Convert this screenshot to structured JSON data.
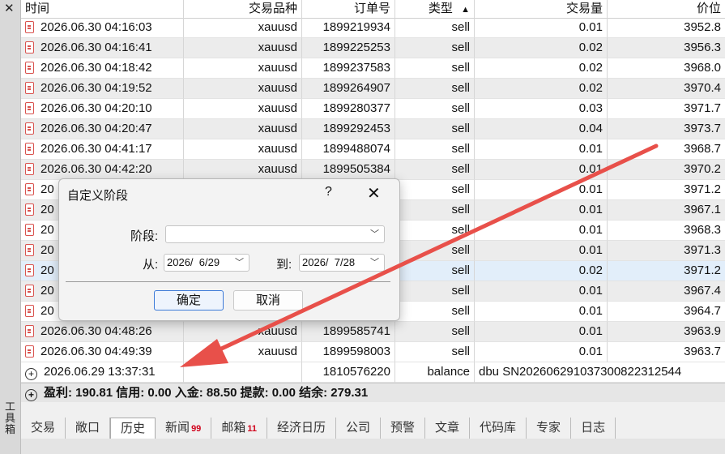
{
  "sidebar": {
    "close_glyph": "✕",
    "label": "工具箱"
  },
  "table": {
    "headers": [
      "时间",
      "交易品种",
      "订单号",
      "类型",
      "交易量",
      "价位"
    ],
    "sort_indicator": "▲",
    "rows": [
      [
        "2026.06.30 04:16:03",
        "xauusd",
        "1899219934",
        "sell",
        "0.01",
        "3952.8"
      ],
      [
        "2026.06.30 04:16:41",
        "xauusd",
        "1899225253",
        "sell",
        "0.02",
        "3956.3"
      ],
      [
        "2026.06.30 04:18:42",
        "xauusd",
        "1899237583",
        "sell",
        "0.02",
        "3968.0"
      ],
      [
        "2026.06.30 04:19:52",
        "xauusd",
        "1899264907",
        "sell",
        "0.02",
        "3970.4"
      ],
      [
        "2026.06.30 04:20:10",
        "xauusd",
        "1899280377",
        "sell",
        "0.03",
        "3971.7"
      ],
      [
        "2026.06.30 04:20:47",
        "xauusd",
        "1899292453",
        "sell",
        "0.04",
        "3973.7"
      ],
      [
        "2026.06.30 04:41:17",
        "xauusd",
        "1899488074",
        "sell",
        "0.01",
        "3968.7"
      ],
      [
        "2026.06.30 04:42:20",
        "xauusd",
        "1899505384",
        "sell",
        "0.01",
        "3970.2"
      ],
      [
        "20",
        "",
        "",
        "sell",
        "0.01",
        "3971.2"
      ],
      [
        "20",
        "",
        "",
        "sell",
        "0.01",
        "3967.1"
      ],
      [
        "20",
        "",
        "",
        "sell",
        "0.01",
        "3968.3"
      ],
      [
        "20",
        "",
        "",
        "sell",
        "0.01",
        "3971.3"
      ],
      [
        "20",
        "",
        "",
        "sell",
        "0.02",
        "3971.2"
      ],
      [
        "20",
        "",
        "",
        "sell",
        "0.01",
        "3967.4"
      ],
      [
        "20",
        "",
        "",
        "sell",
        "0.01",
        "3964.7"
      ],
      [
        "2026.06.30 04:48:26",
        "xauusd",
        "1899585741",
        "sell",
        "0.01",
        "3963.9"
      ],
      [
        "2026.06.30 04:49:39",
        "xauusd",
        "1899598003",
        "sell",
        "0.01",
        "3963.7"
      ]
    ],
    "balance_row": {
      "time": "2026.06.29 13:37:31",
      "order": "1810576220",
      "type": "balance",
      "comment": "dbu SN202606291037300822312544"
    },
    "summary": "盈利: 190.81  信用: 0.00  入金: 88.50  提款: 0.00  结余: 279.31"
  },
  "tabs": [
    {
      "label": "交易"
    },
    {
      "label": "敞口"
    },
    {
      "label": "历史",
      "active": true
    },
    {
      "label": "新闻",
      "badge": "99"
    },
    {
      "label": "邮箱",
      "badge": "11"
    },
    {
      "label": "经济日历"
    },
    {
      "label": "公司"
    },
    {
      "label": "预警"
    },
    {
      "label": "文章"
    },
    {
      "label": "代码库"
    },
    {
      "label": "专家"
    },
    {
      "label": "日志"
    }
  ],
  "dialog": {
    "title": "自定义阶段",
    "help": "?",
    "close": "✕",
    "period_label": "阶段:",
    "period_value": "",
    "from_label": "从:",
    "from_value": "2026/  6/29",
    "to_label": "到:",
    "to_value": "2026/  7/28",
    "ok_label": "确定",
    "cancel_label": "取消"
  },
  "colors": {
    "arrow": "#e8504a",
    "selected_row": "#e2eefa",
    "badge": "#d0021b"
  }
}
